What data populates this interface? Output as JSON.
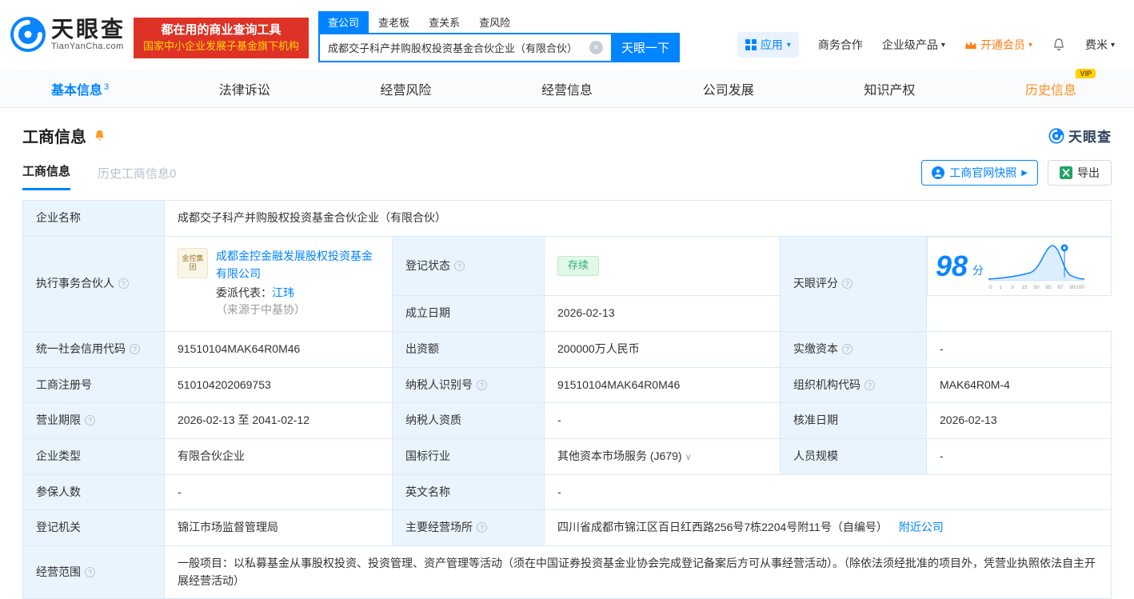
{
  "header": {
    "logo_title": "天眼查",
    "logo_domain": "TianYanCha.com",
    "banner_line1": "都在用的商业查询工具",
    "banner_line2": "国家中小企业发展子基金旗下机构",
    "search_tabs": [
      {
        "label": "查公司",
        "active": true
      },
      {
        "label": "查老板",
        "active": false
      },
      {
        "label": "查关系",
        "active": false
      },
      {
        "label": "查风险",
        "active": false
      }
    ],
    "search_value": "成都交子科产并购股权投资基金合伙企业（有限合伙）",
    "search_button": "天眼一下",
    "menu": {
      "apps": "应用",
      "business": "商务合作",
      "enterprise": "企业级产品",
      "member": "开通会员",
      "user": "费米"
    }
  },
  "nav_tabs": [
    {
      "label": "基本信息",
      "badge": "3",
      "active": true
    },
    {
      "label": "法律诉讼"
    },
    {
      "label": "经营风险"
    },
    {
      "label": "经营信息"
    },
    {
      "label": "公司发展"
    },
    {
      "label": "知识产权"
    },
    {
      "label": "历史信息",
      "vip": "VIP"
    }
  ],
  "section": {
    "title": "工商信息",
    "brand": "天眼查",
    "subtab_active": "工商信息",
    "subtab_history": "历史工商信息0",
    "snapshot_button": "工商官网快照",
    "export_button": "导出"
  },
  "table": {
    "company_name_label": "企业名称",
    "company_name": "成都交子科产并购股权投资基金合伙企业（有限合伙）",
    "partner_label": "执行事务合伙人",
    "partner_logo": "金控集团",
    "partner_company": "成都金控金融发展股权投资基金有限公司",
    "delegate_prefix": "委派代表：",
    "delegate_name": "江玮",
    "delegate_source": "（来源于中基协）",
    "reg_status_label": "登记状态",
    "reg_status": "存续",
    "establish_date_label": "成立日期",
    "establish_date": "2026-02-13",
    "score_label": "天眼评分",
    "score": "98",
    "score_unit": "分",
    "credit_code_label": "统一社会信用代码",
    "credit_code": "91510104MAK64R0M46",
    "capital_label": "出资额",
    "capital": "200000万人民币",
    "paid_capital_label": "实缴资本",
    "paid_capital": "-",
    "reg_number_label": "工商注册号",
    "reg_number": "510104202069753",
    "taxpayer_id_label": "纳税人识别号",
    "taxpayer_id": "91510104MAK64R0M46",
    "org_code_label": "组织机构代码",
    "org_code": "MAK64R0M-4",
    "business_term_label": "营业期限",
    "business_term": "2026-02-13 至 2041-02-12",
    "taxpayer_quality_label": "纳税人资质",
    "taxpayer_quality": "-",
    "approval_date_label": "核准日期",
    "approval_date": "2026-02-13",
    "company_type_label": "企业类型",
    "company_type": "有限合伙企业",
    "industry_label": "国标行业",
    "industry": "其他资本市场服务 (J679)",
    "staff_size_label": "人员规模",
    "staff_size": "-",
    "insured_label": "参保人数",
    "insured": "-",
    "english_name_label": "英文名称",
    "english_name": "-",
    "reg_authority_label": "登记机关",
    "reg_authority": "锦江市场监督管理局",
    "address_label": "主要经营场所",
    "address": "四川省成都市锦江区百日红西路256号7栋2204号附11号（自编号）",
    "nearby_link": "附近公司",
    "business_scope_label": "经营范围",
    "business_scope": "一般项目：以私募基金从事股权投资、投资管理、资产管理等活动（须在中国证券投资基金业协会完成登记备案后方可从事经营活动）。（除依法须经批准的项目外，凭营业执照依法自主开展经营活动）"
  },
  "chart_data": {
    "type": "line",
    "title": "天眼评分",
    "score": 98,
    "score_unit": "分",
    "x_ticks": [
      "0",
      "1",
      "3",
      "15",
      "50",
      "85",
      "97",
      "99",
      "100"
    ],
    "marker_x": 98,
    "curve": "score-distribution bell curve, marker pin at score 98",
    "grid": false,
    "legend_position": "none",
    "accent_color": "#0a85ff"
  },
  "colors": {
    "primary_blue": "#0084ff",
    "banner_red": "#de3226",
    "banner_yellow": "#ffd900",
    "member_orange": "#ff7e15",
    "vip_orange": "#ff8f1f",
    "label_bg": "#e9f4fe",
    "status_green": "#2ab065"
  }
}
